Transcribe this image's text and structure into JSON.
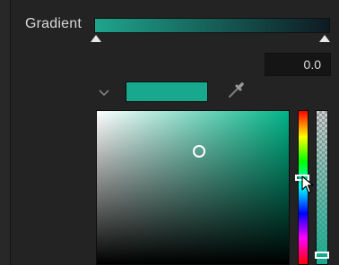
{
  "gradient": {
    "label": "Gradient",
    "start_color": "#1ea58c",
    "end_color": "#0e1a22"
  },
  "value_field": {
    "value": "0.0"
  },
  "picker": {
    "current_color": "#17a88e",
    "hue_color": "#00b487",
    "hue_level": 0.42,
    "alpha_level": 1.0
  },
  "icons": {
    "collapse": "chevron-down-icon",
    "eyedropper": "eyedropper-icon",
    "pointer": "mouse-pointer-icon"
  }
}
